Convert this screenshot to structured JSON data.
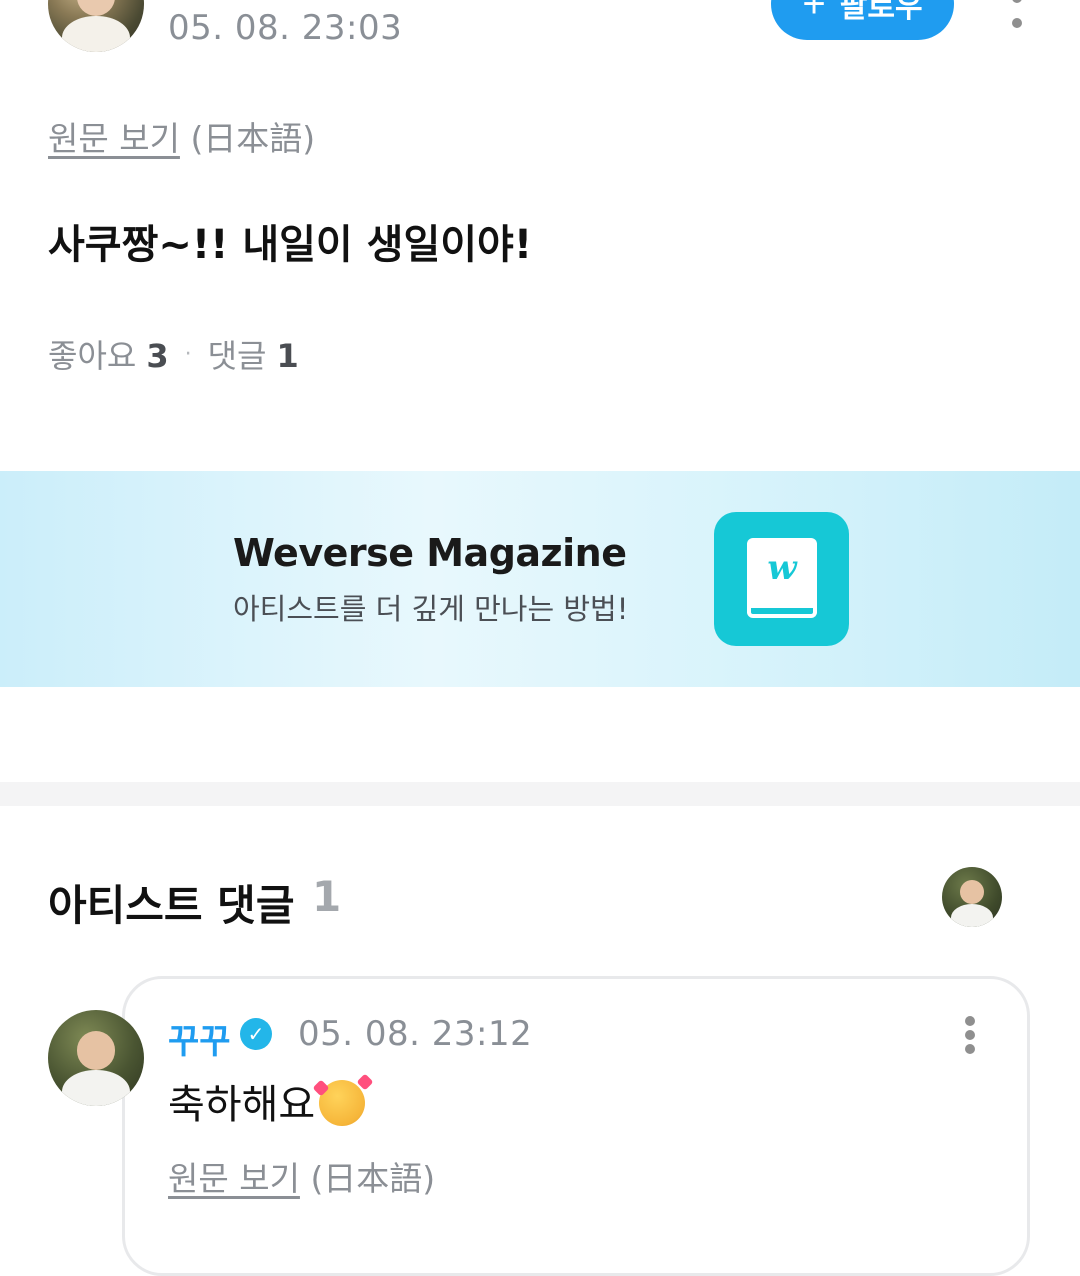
{
  "post": {
    "timestamp": "05. 08. 23:03",
    "follow_label": "팔로우",
    "follow_icon": "+",
    "original_link": "원문 보기",
    "original_lang": "(日本語)",
    "text": "사쿠짱~!! 내일이 생일이야!",
    "likes_label": "좋아요",
    "likes_count": "3",
    "separator": "·",
    "comments_label": "댓글",
    "comments_count": "1"
  },
  "banner": {
    "title": "Weverse Magazine",
    "subtitle": "아티스트를 더 깊게 만나는 방법!",
    "icon_letter": "w"
  },
  "artist_comments": {
    "title": "아티스트 댓글",
    "count": "1",
    "items": [
      {
        "author": "꾸꾸",
        "verified_icon": "✓",
        "timestamp": "05. 08. 23:12",
        "text": "축하해요",
        "original_link": "원문 보기",
        "original_lang": "(日本語)"
      }
    ]
  },
  "colors": {
    "accent": "#1f9cf0",
    "muted_text": "#8b8f95",
    "banner_icon": "#16c8d6"
  }
}
